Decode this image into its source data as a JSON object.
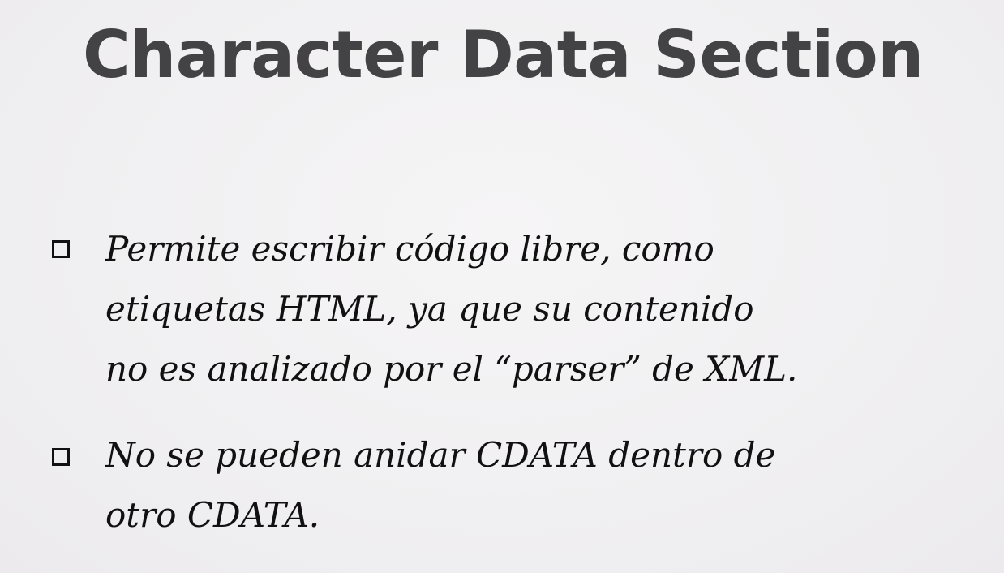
{
  "slide": {
    "title": "Character Data Section",
    "bullets": [
      {
        "lines": [
          "Permite escribir código libre, como",
          "etiquetas HTML, ya que su contenido",
          "no es analizado por el “parser” de XML."
        ]
      },
      {
        "lines": [
          "No se pueden anidar CDATA dentro de",
          "otro CDATA."
        ]
      }
    ]
  },
  "colors": {
    "background": "#f1f0f1",
    "title": "#434245",
    "body_text": "#111111"
  },
  "icons": {
    "bullet": "square-checkbox-icon"
  }
}
